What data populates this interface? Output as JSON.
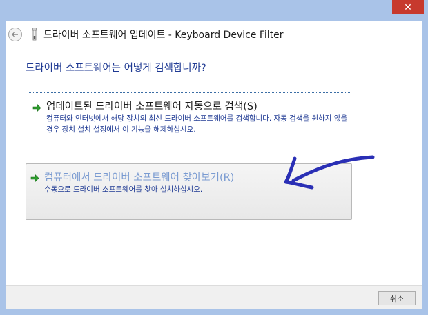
{
  "window": {
    "close_label": "✕"
  },
  "header": {
    "title": "드라이버 소프트웨어 업데이트 - Keyboard Device Filter"
  },
  "question": "드라이버 소프트웨어는 어떻게 검색합니까?",
  "options": [
    {
      "title": "업데이트된 드라이버 소프트웨어 자동으로 검색(S)",
      "description": "컴퓨터와 인터넷에서 해당 장치의 최신 드라이버 소프트웨어를 검색합니다. 자동 검색을 원하지 않을 경우 장치 설치 설정에서 이 기능을 해제하십시오."
    },
    {
      "title": "컴퓨터에서 드라이버 소프트웨어 찾아보기(R)",
      "description": "수동으로 드라이버 소프트웨어를 찾아 설치하십시오."
    }
  ],
  "footer": {
    "cancel_label": "취소"
  },
  "colors": {
    "accent": "#1f3a93",
    "annotation": "#2a2fb5",
    "arrow_green": "#2e9e2e",
    "close_red": "#c7392d"
  },
  "icons": [
    "back-arrow-icon",
    "wizard-icon",
    "green-arrow-icon",
    "annotation-arrow"
  ]
}
